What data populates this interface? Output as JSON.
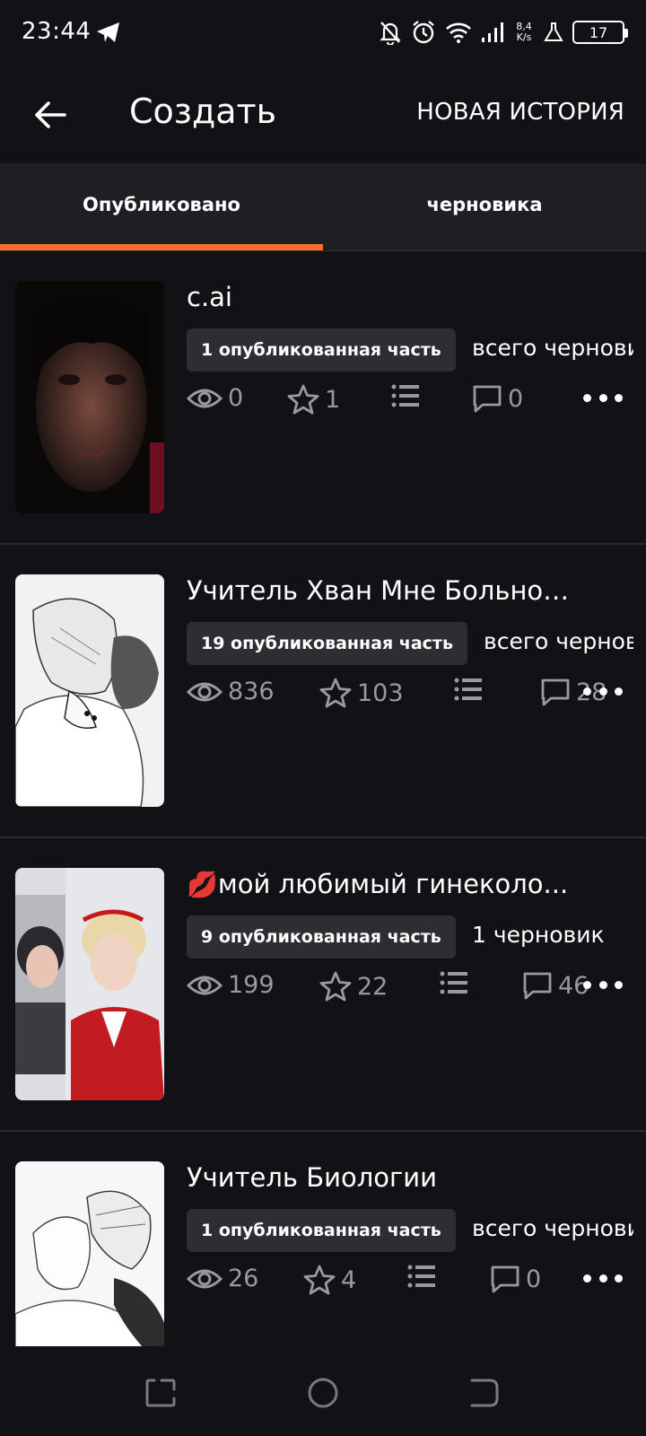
{
  "status_bar": {
    "time": "23:44",
    "net_speed_value": "8,4",
    "net_speed_unit": "K/s",
    "battery": "17",
    "icons": [
      "telegram-icon",
      "mute-bell-icon",
      "alarm-icon",
      "wifi-icon",
      "signal-icon",
      "lab-flask-icon",
      "battery-icon"
    ]
  },
  "app_bar": {
    "title": "Создать",
    "new_story": "НОВАЯ ИСТОРИЯ"
  },
  "tabs": [
    {
      "label": "Опубликовано",
      "active": true
    },
    {
      "label": "черновика",
      "active": false
    }
  ],
  "accent_color": "#ff6b2b",
  "stories": [
    {
      "title": "c.ai",
      "emoji": "",
      "published": "1 опубликованная часть",
      "drafts": "всего черновиков",
      "views": "0",
      "votes": "1",
      "comments": "0"
    },
    {
      "title": "Учитель Хван Мне Больно[...",
      "emoji": "",
      "published": "19 опубликованная часть",
      "drafts": "всего черновиков",
      "views": "836",
      "votes": "103",
      "comments": "28"
    },
    {
      "title": "мой любимый гинеколо...",
      "emoji": "💋",
      "published": "9 опубликованная часть",
      "drafts": "1 черновик",
      "views": "199",
      "votes": "22",
      "comments": "46"
    },
    {
      "title": "Учитель Биологии",
      "emoji": "",
      "published": "1 опубликованная часть",
      "drafts": "всего черновиков",
      "views": "26",
      "votes": "4",
      "comments": "0"
    }
  ]
}
